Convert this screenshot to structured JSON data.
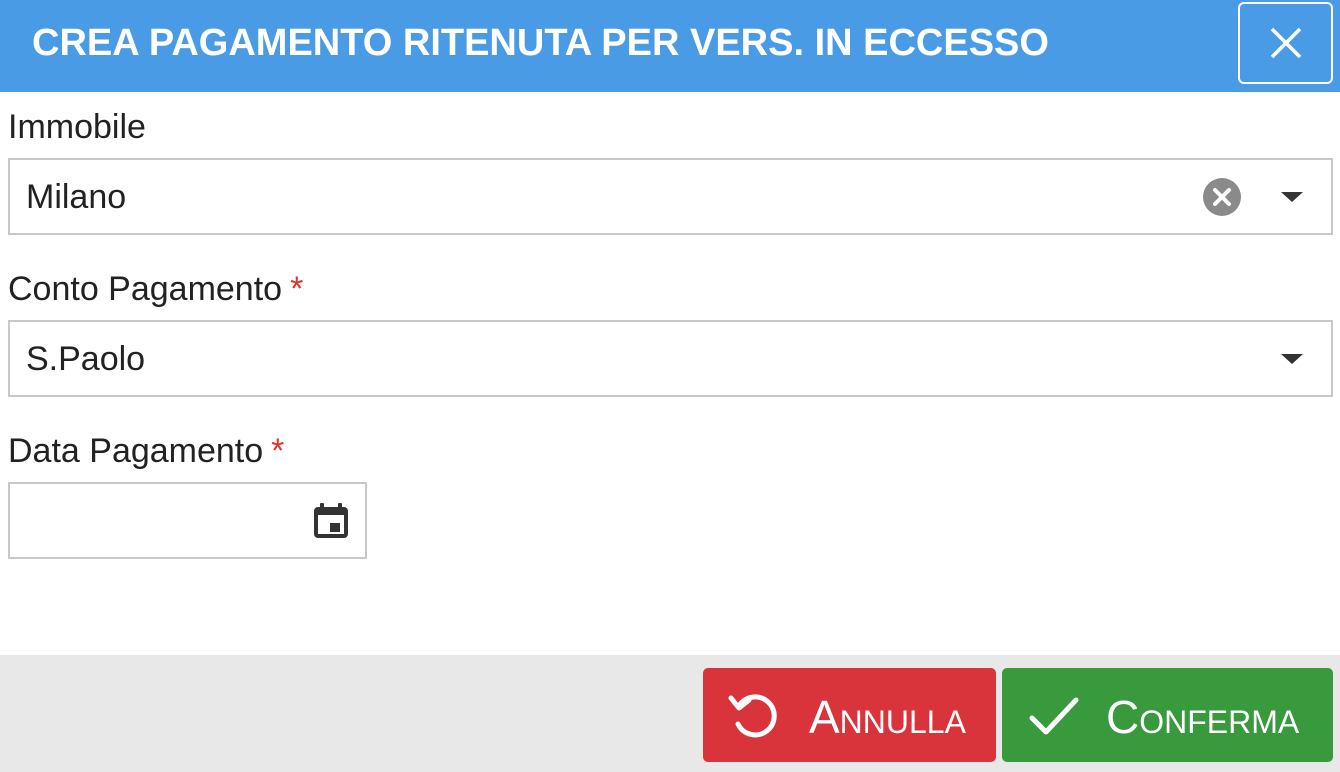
{
  "dialog": {
    "title": "CREA PAGAMENTO RITENUTA PER VERS. IN ECCESSO",
    "close_icon": "close-icon"
  },
  "fields": {
    "immobile": {
      "label": "Immobile",
      "value": "Milano",
      "required": false
    },
    "conto": {
      "label": "Conto Pagamento",
      "required_mark": "*",
      "value": "S.Paolo"
    },
    "data": {
      "label": "Data Pagamento",
      "required_mark": "*",
      "value": ""
    }
  },
  "footer": {
    "cancel_label": "Annulla",
    "confirm_label": "Conferma"
  },
  "colors": {
    "header": "#4a9be6",
    "cancel": "#d9343c",
    "confirm": "#389a3d",
    "required": "#d33"
  }
}
